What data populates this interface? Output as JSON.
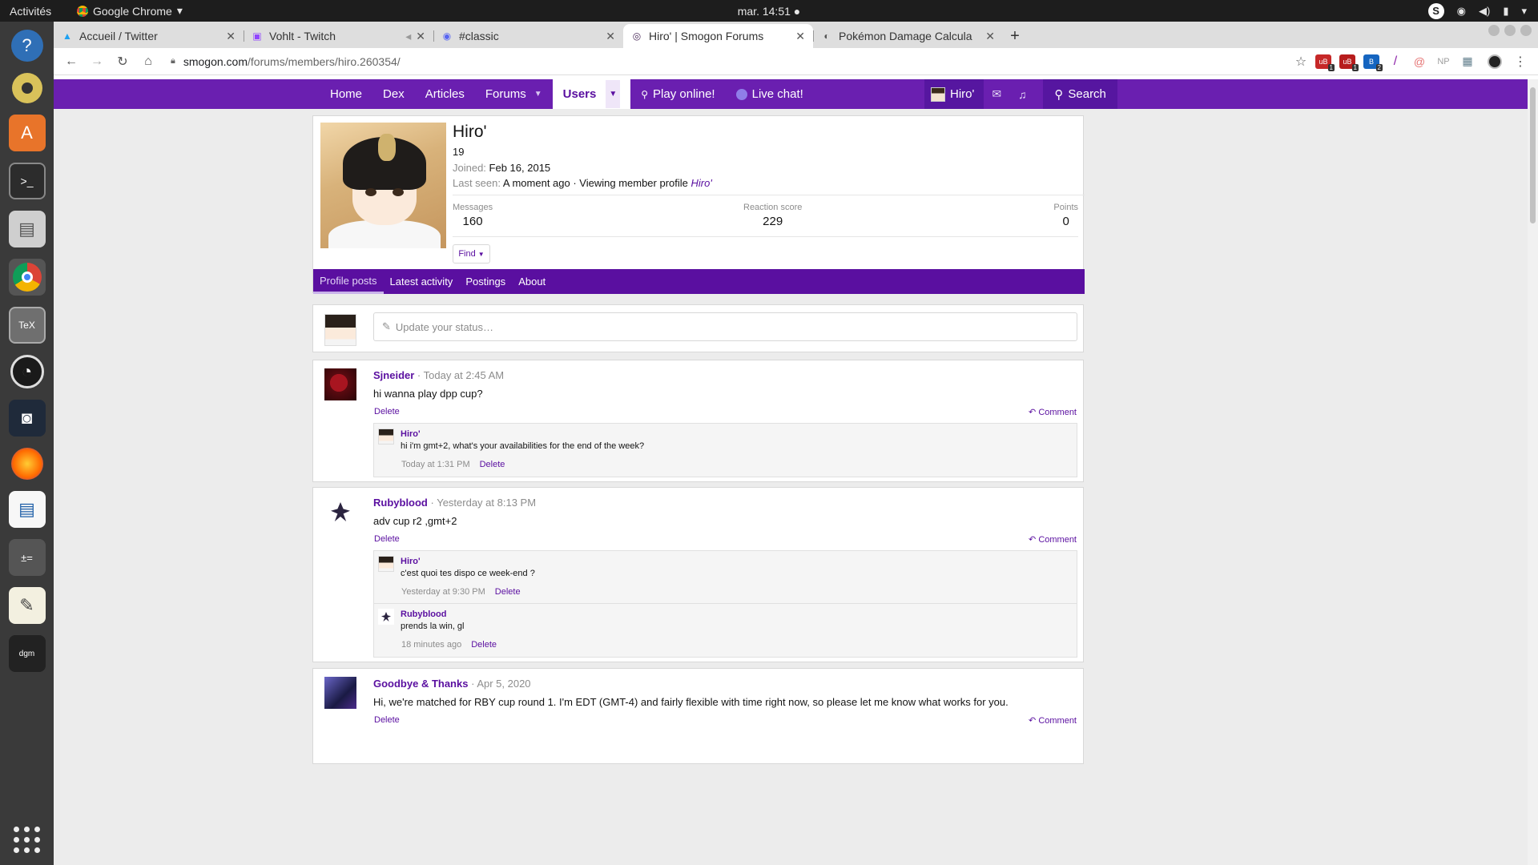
{
  "desktop": {
    "activities": "Activités",
    "app_name": "Google Chrome",
    "clock": "mar. 14:51",
    "tray_s": "S"
  },
  "browser": {
    "tabs": [
      {
        "label": "Accueil / Twitter",
        "icon": "twitter-icon",
        "color": "#1da1f2"
      },
      {
        "label": "Vohlt - Twitch",
        "icon": "twitch-icon",
        "color": "#9146ff"
      },
      {
        "label": "#classic",
        "icon": "discord-icon",
        "color": "#5865f2"
      },
      {
        "label": "Hiro' | Smogon Forums",
        "icon": "smogon-icon",
        "color": "#4a2a5a"
      },
      {
        "label": "Pokémon Damage Calcula",
        "icon": "calc-icon",
        "color": "#555555"
      }
    ],
    "url_host": "smogon.com",
    "url_path": "/forums/members/hiro.260354/",
    "extensions": [
      {
        "label": "uB",
        "color": "#c62828",
        "badge": "1"
      },
      {
        "label": "uB",
        "color": "#b71c1c",
        "badge": "1"
      },
      {
        "label": "B",
        "color": "#1565c0",
        "badge": "2"
      },
      {
        "label": "/",
        "color": "#8e24aa"
      },
      {
        "label": "@",
        "color": "#e57373"
      },
      {
        "label": "NP",
        "color": "#9e9e9e"
      },
      {
        "label": "▦",
        "color": "#607d8b"
      }
    ]
  },
  "site_nav": {
    "links": [
      {
        "label": "Home"
      },
      {
        "label": "Dex"
      },
      {
        "label": "Articles"
      },
      {
        "label": "Forums"
      },
      {
        "label": "Users"
      },
      {
        "label": "Play online!"
      },
      {
        "label": "Live chat!"
      }
    ],
    "user": "Hiro'",
    "search": "Search"
  },
  "profile": {
    "name": "Hiro'",
    "age": "19",
    "joined_label": "Joined:",
    "joined_value": "Feb 16, 2015",
    "last_seen_label": "Last seen:",
    "last_seen_value": "A moment ago · Viewing member profile",
    "last_seen_link": "Hiro'",
    "stats": [
      {
        "label": "Messages",
        "value": "160"
      },
      {
        "label": "Reaction score",
        "value": "229"
      },
      {
        "label": "Points",
        "value": "0"
      }
    ],
    "find": "Find",
    "tabs": [
      "Profile posts",
      "Latest activity",
      "Postings",
      "About"
    ]
  },
  "status_placeholder": "Update your status…",
  "posts": [
    {
      "user": "Sjneider",
      "date": "· Today at 2:45 AM",
      "text": "hi wanna play dpp cup?",
      "delete": "Delete",
      "comment": "Comment",
      "comments": [
        {
          "user": "Hiro'",
          "text": "hi i'm gmt+2, what's your availabilities for the end of the week?",
          "date": "Today at 1:31 PM",
          "delete": "Delete"
        }
      ]
    },
    {
      "user": "Rubyblood",
      "date": "· Yesterday at 8:13 PM",
      "text": "adv cup r2 ,gmt+2",
      "delete": "Delete",
      "comment": "Comment",
      "comments": [
        {
          "user": "Hiro'",
          "text": "c'est quoi tes dispo ce week-end ?",
          "date": "Yesterday at 9:30 PM",
          "delete": "Delete"
        },
        {
          "user": "Rubyblood",
          "text": "prends la win, gl",
          "date": "18 minutes ago",
          "delete": "Delete"
        }
      ]
    },
    {
      "user": "Goodbye & Thanks",
      "date": "· Apr 5, 2020",
      "text": "Hi, we're matched for RBY cup round 1. I'm EDT (GMT-4) and fairly flexible with time right now, so please let me know what works for you.",
      "delete": "Delete",
      "comment": "Comment"
    }
  ]
}
